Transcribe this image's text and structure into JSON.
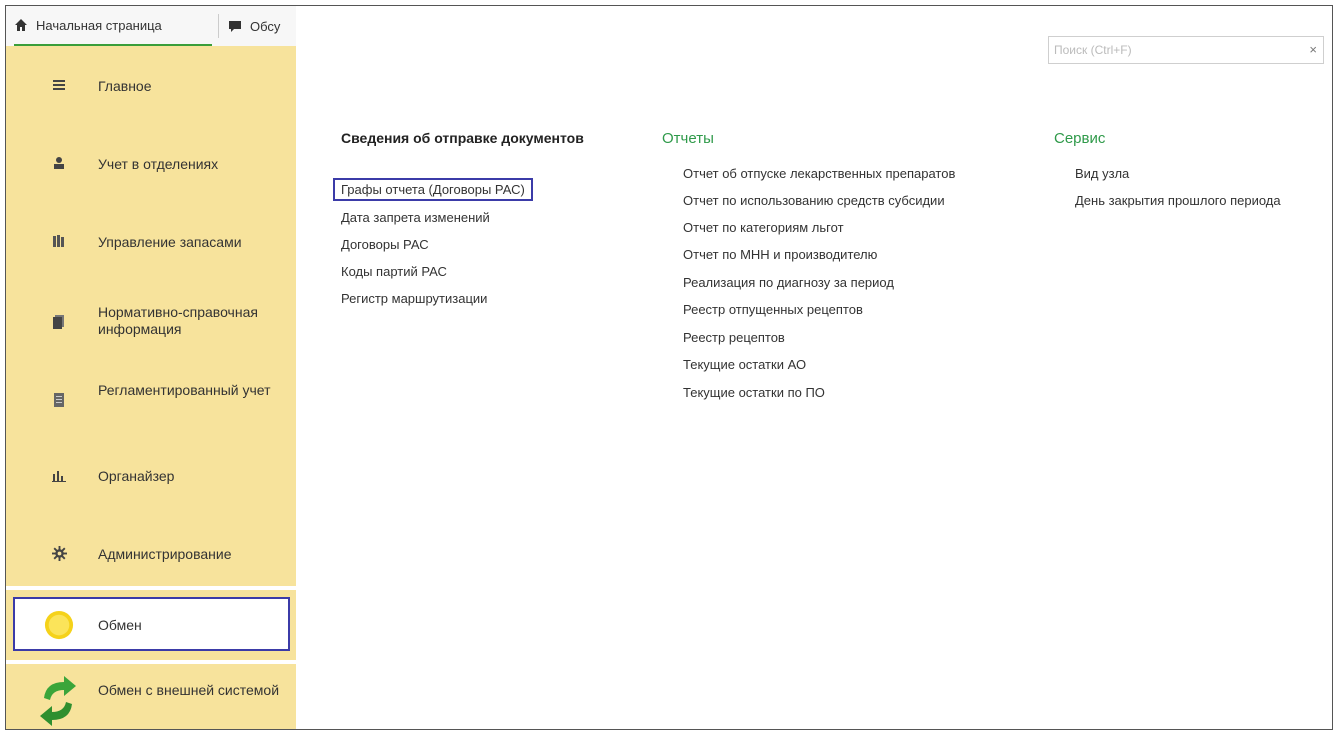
{
  "tabs": {
    "home_label": "Начальная страница",
    "discussions_label": "Обсу"
  },
  "sidebar": {
    "items": [
      {
        "label": "Главное",
        "icon": "list-icon"
      },
      {
        "label": "Учет в отделениях",
        "icon": "person-icon"
      },
      {
        "label": "Управление запасами",
        "icon": "books-icon"
      },
      {
        "label": "Нормативно-справочная информация",
        "icon": "folder-icon"
      },
      {
        "label": "Регламентированный учет",
        "icon": "document-icon"
      },
      {
        "label": "Органайзер",
        "icon": "chart-icon"
      },
      {
        "label": "Администрирование",
        "icon": "gear-icon"
      },
      {
        "label": "Обмен",
        "icon": "sun-icon"
      },
      {
        "label": "Обмен с внешней системой",
        "icon": "sync-arrows-icon"
      }
    ]
  },
  "search": {
    "placeholder": "Поиск (Ctrl+F)",
    "clear": "×"
  },
  "columns": {
    "info": {
      "title": "Сведения об отправке документов",
      "links": [
        "Графы отчета (Договоры РАС)",
        "Дата запрета изменений",
        "Договоры РАС",
        "Коды партий РАС",
        "Регистр маршрутизации"
      ]
    },
    "reports": {
      "title": "Отчеты",
      "links": [
        "Отчет об отпуске лекарственных препаратов",
        "Отчет по использованию средств субсидии",
        "Отчет по категориям льгот",
        "Отчет по МНН и производителю",
        "Реализация по диагнозу за период",
        "Реестр отпущенных рецептов",
        "Реестр рецептов",
        "Текущие остатки АО",
        "Текущие остатки по ПО"
      ]
    },
    "service": {
      "title": "Сервис",
      "links": [
        "Вид узла",
        "День закрытия прошлого периода"
      ]
    }
  },
  "colors": {
    "sidebar_bg": "#f7e39c",
    "accent_green": "#2f9a4a",
    "highlight_border": "#3b3ba8"
  }
}
